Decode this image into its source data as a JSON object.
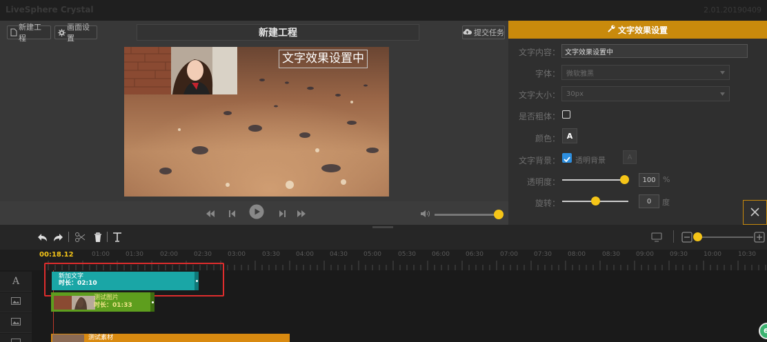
{
  "app": {
    "title": "LiveSphere Crystal",
    "version": "2.01.20190409"
  },
  "toolbar": {
    "new_project": "新建工程",
    "screen_settings": "画面设置",
    "project_title": "新建工程",
    "submit_task": "提交任务"
  },
  "preview": {
    "overlay_text": "文字效果设置中"
  },
  "volume": {
    "level": 0.98
  },
  "text_panel": {
    "header": "文字效果设置",
    "content_label": "文字内容：",
    "content_value": "文字效果设置中",
    "font_label": "字体：",
    "font_value": "微软雅黑",
    "size_label": "文字大小：",
    "size_value": "30px",
    "bold_label": "是否粗体：",
    "color_label": "颜色：",
    "color_swatch": "A",
    "bg_label": "文字背景：",
    "transparent_label": "透明背景",
    "bg_swatch": "A",
    "opacity_label": "透明度：",
    "opacity_value": "100",
    "opacity_unit": "%",
    "rotate_label": "旋转：",
    "rotate_value": "0",
    "rotate_unit": "度"
  },
  "timeline": {
    "current_time": "00:18.12",
    "ticks": [
      "01:00",
      "01:30",
      "02:00",
      "02:30",
      "03:00",
      "03:30",
      "04:00",
      "04:30",
      "05:00",
      "05:30",
      "06:00",
      "06:30",
      "07:00",
      "07:30",
      "08:00",
      "08:30",
      "09:00",
      "09:30",
      "10:00",
      "10:30"
    ],
    "clips": {
      "text": {
        "title": "新加文字",
        "duration": "时长：02:10"
      },
      "image": {
        "title": "测试图片",
        "duration": "时长：01:33"
      },
      "video": {
        "title": "测试素材"
      }
    },
    "zoom_badge": "6"
  },
  "colors": {
    "accent": "#c98a0c",
    "thumb": "#f5c518",
    "text_clip": "#1aa6a6",
    "image_clip": "#5e9e1e",
    "video_clip": "#d98a10"
  }
}
